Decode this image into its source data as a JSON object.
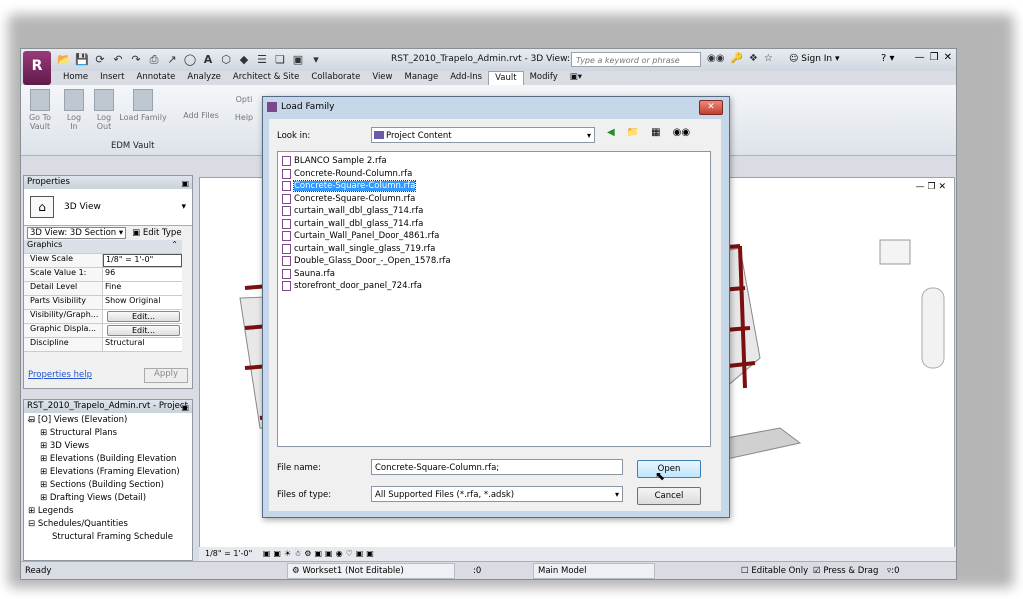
{
  "app": {
    "logo_letter": "R",
    "doc_title": "RST_2010_Trapelo_Admin.rvt - 3D View: ...",
    "search_placeholder": "Type a keyword or phrase",
    "sign_in": "Sign In",
    "help": "?"
  },
  "ribbon_tabs": [
    "Home",
    "Insert",
    "Annotate",
    "Analyze",
    "Architect & Site",
    "Collaborate",
    "View",
    "Manage",
    "Add-Ins",
    "Vault",
    "Modify"
  ],
  "active_tab": "Vault",
  "ribbon_buttons": [
    {
      "label": "Go To\nVault"
    },
    {
      "label": "Log\nIn"
    },
    {
      "label": "Log\nOut"
    },
    {
      "label": "Load Family"
    },
    {
      "label": "Add Files"
    }
  ],
  "ribbon_partial": [
    "Opti",
    "Help"
  ],
  "ribbon_panel_label": "EDM Vault",
  "properties": {
    "title": "Properties",
    "type_name": "3D View",
    "instance_selector": "3D View: 3D Section",
    "edit_type": "Edit Type",
    "group": "Graphics",
    "rows": [
      {
        "k": "View Scale",
        "v": "1/8\" = 1'-0\""
      },
      {
        "k": "Scale Value   1:",
        "v": "96"
      },
      {
        "k": "Detail Level",
        "v": "Fine"
      },
      {
        "k": "Parts Visibility",
        "v": "Show Original"
      },
      {
        "k": "Visibility/Graph...",
        "v": "Edit..."
      },
      {
        "k": "Graphic Displa...",
        "v": "Edit..."
      },
      {
        "k": "Discipline",
        "v": "Structural"
      }
    ],
    "help_link": "Properties help",
    "apply": "Apply"
  },
  "browser": {
    "title": "RST_2010_Trapelo_Admin.rvt - Project ...",
    "items": [
      "[O] Views (Elevation)",
      "Structural Plans",
      "3D Views",
      "Elevations (Building Elevation",
      "Elevations (Framing Elevation)",
      "Sections (Building Section)",
      "Drafting Views (Detail)",
      "Legends",
      "Schedules/Quantities",
      "Structural Framing Schedule"
    ]
  },
  "view_bar": {
    "scale": "1/8\" = 1'-0\""
  },
  "status": {
    "ready": "Ready",
    "workset": "Workset1 (Not Editable)",
    "count": ":0",
    "model": "Main Model",
    "editable_only": "Editable Only",
    "press_drag": "Press & Drag",
    "filter": ":0"
  },
  "dialog": {
    "title": "Load Family",
    "look_in_label": "Look in:",
    "look_in_value": "Project Content",
    "files": [
      "BLANCO Sample 2.rfa",
      "Concrete-Round-Column.rfa",
      "Concrete-Square-Column.rfa",
      "Concrete-Square-Column.rfa",
      "curtain_wall_dbl_glass_714.rfa",
      "curtain_wall_dbl_glass_714.rfa",
      "Curtain_Wall_Panel_Door_4861.rfa",
      "curtain_wall_single_glass_719.rfa",
      "Double_Glass_Door_-_Open_1578.rfa",
      "Sauna.rfa",
      "storefront_door_panel_724.rfa"
    ],
    "selected_index": 2,
    "file_name_label": "File name:",
    "file_name_value": "Concrete-Square-Column.rfa;",
    "files_of_type_label": "Files of type:",
    "files_of_type_value": "All Supported Files (*.rfa, *.adsk)",
    "open": "Open",
    "cancel": "Cancel"
  },
  "colors": {
    "selection": "#3399ff",
    "brand": "#7a2a6a",
    "beam": "#7a1010"
  }
}
